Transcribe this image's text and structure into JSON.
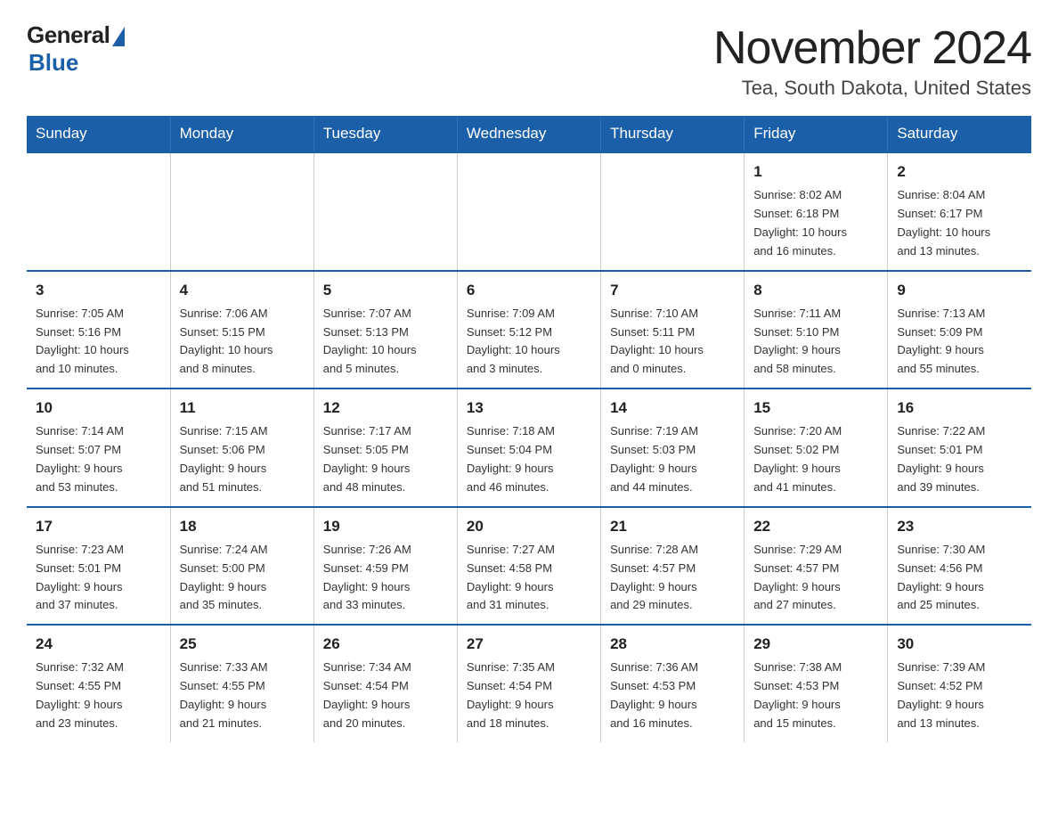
{
  "logo": {
    "general": "General",
    "blue": "Blue"
  },
  "title": "November 2024",
  "subtitle": "Tea, South Dakota, United States",
  "weekdays": [
    "Sunday",
    "Monday",
    "Tuesday",
    "Wednesday",
    "Thursday",
    "Friday",
    "Saturday"
  ],
  "rows": [
    [
      {
        "day": "",
        "info": ""
      },
      {
        "day": "",
        "info": ""
      },
      {
        "day": "",
        "info": ""
      },
      {
        "day": "",
        "info": ""
      },
      {
        "day": "",
        "info": ""
      },
      {
        "day": "1",
        "info": "Sunrise: 8:02 AM\nSunset: 6:18 PM\nDaylight: 10 hours\nand 16 minutes."
      },
      {
        "day": "2",
        "info": "Sunrise: 8:04 AM\nSunset: 6:17 PM\nDaylight: 10 hours\nand 13 minutes."
      }
    ],
    [
      {
        "day": "3",
        "info": "Sunrise: 7:05 AM\nSunset: 5:16 PM\nDaylight: 10 hours\nand 10 minutes."
      },
      {
        "day": "4",
        "info": "Sunrise: 7:06 AM\nSunset: 5:15 PM\nDaylight: 10 hours\nand 8 minutes."
      },
      {
        "day": "5",
        "info": "Sunrise: 7:07 AM\nSunset: 5:13 PM\nDaylight: 10 hours\nand 5 minutes."
      },
      {
        "day": "6",
        "info": "Sunrise: 7:09 AM\nSunset: 5:12 PM\nDaylight: 10 hours\nand 3 minutes."
      },
      {
        "day": "7",
        "info": "Sunrise: 7:10 AM\nSunset: 5:11 PM\nDaylight: 10 hours\nand 0 minutes."
      },
      {
        "day": "8",
        "info": "Sunrise: 7:11 AM\nSunset: 5:10 PM\nDaylight: 9 hours\nand 58 minutes."
      },
      {
        "day": "9",
        "info": "Sunrise: 7:13 AM\nSunset: 5:09 PM\nDaylight: 9 hours\nand 55 minutes."
      }
    ],
    [
      {
        "day": "10",
        "info": "Sunrise: 7:14 AM\nSunset: 5:07 PM\nDaylight: 9 hours\nand 53 minutes."
      },
      {
        "day": "11",
        "info": "Sunrise: 7:15 AM\nSunset: 5:06 PM\nDaylight: 9 hours\nand 51 minutes."
      },
      {
        "day": "12",
        "info": "Sunrise: 7:17 AM\nSunset: 5:05 PM\nDaylight: 9 hours\nand 48 minutes."
      },
      {
        "day": "13",
        "info": "Sunrise: 7:18 AM\nSunset: 5:04 PM\nDaylight: 9 hours\nand 46 minutes."
      },
      {
        "day": "14",
        "info": "Sunrise: 7:19 AM\nSunset: 5:03 PM\nDaylight: 9 hours\nand 44 minutes."
      },
      {
        "day": "15",
        "info": "Sunrise: 7:20 AM\nSunset: 5:02 PM\nDaylight: 9 hours\nand 41 minutes."
      },
      {
        "day": "16",
        "info": "Sunrise: 7:22 AM\nSunset: 5:01 PM\nDaylight: 9 hours\nand 39 minutes."
      }
    ],
    [
      {
        "day": "17",
        "info": "Sunrise: 7:23 AM\nSunset: 5:01 PM\nDaylight: 9 hours\nand 37 minutes."
      },
      {
        "day": "18",
        "info": "Sunrise: 7:24 AM\nSunset: 5:00 PM\nDaylight: 9 hours\nand 35 minutes."
      },
      {
        "day": "19",
        "info": "Sunrise: 7:26 AM\nSunset: 4:59 PM\nDaylight: 9 hours\nand 33 minutes."
      },
      {
        "day": "20",
        "info": "Sunrise: 7:27 AM\nSunset: 4:58 PM\nDaylight: 9 hours\nand 31 minutes."
      },
      {
        "day": "21",
        "info": "Sunrise: 7:28 AM\nSunset: 4:57 PM\nDaylight: 9 hours\nand 29 minutes."
      },
      {
        "day": "22",
        "info": "Sunrise: 7:29 AM\nSunset: 4:57 PM\nDaylight: 9 hours\nand 27 minutes."
      },
      {
        "day": "23",
        "info": "Sunrise: 7:30 AM\nSunset: 4:56 PM\nDaylight: 9 hours\nand 25 minutes."
      }
    ],
    [
      {
        "day": "24",
        "info": "Sunrise: 7:32 AM\nSunset: 4:55 PM\nDaylight: 9 hours\nand 23 minutes."
      },
      {
        "day": "25",
        "info": "Sunrise: 7:33 AM\nSunset: 4:55 PM\nDaylight: 9 hours\nand 21 minutes."
      },
      {
        "day": "26",
        "info": "Sunrise: 7:34 AM\nSunset: 4:54 PM\nDaylight: 9 hours\nand 20 minutes."
      },
      {
        "day": "27",
        "info": "Sunrise: 7:35 AM\nSunset: 4:54 PM\nDaylight: 9 hours\nand 18 minutes."
      },
      {
        "day": "28",
        "info": "Sunrise: 7:36 AM\nSunset: 4:53 PM\nDaylight: 9 hours\nand 16 minutes."
      },
      {
        "day": "29",
        "info": "Sunrise: 7:38 AM\nSunset: 4:53 PM\nDaylight: 9 hours\nand 15 minutes."
      },
      {
        "day": "30",
        "info": "Sunrise: 7:39 AM\nSunset: 4:52 PM\nDaylight: 9 hours\nand 13 minutes."
      }
    ]
  ]
}
